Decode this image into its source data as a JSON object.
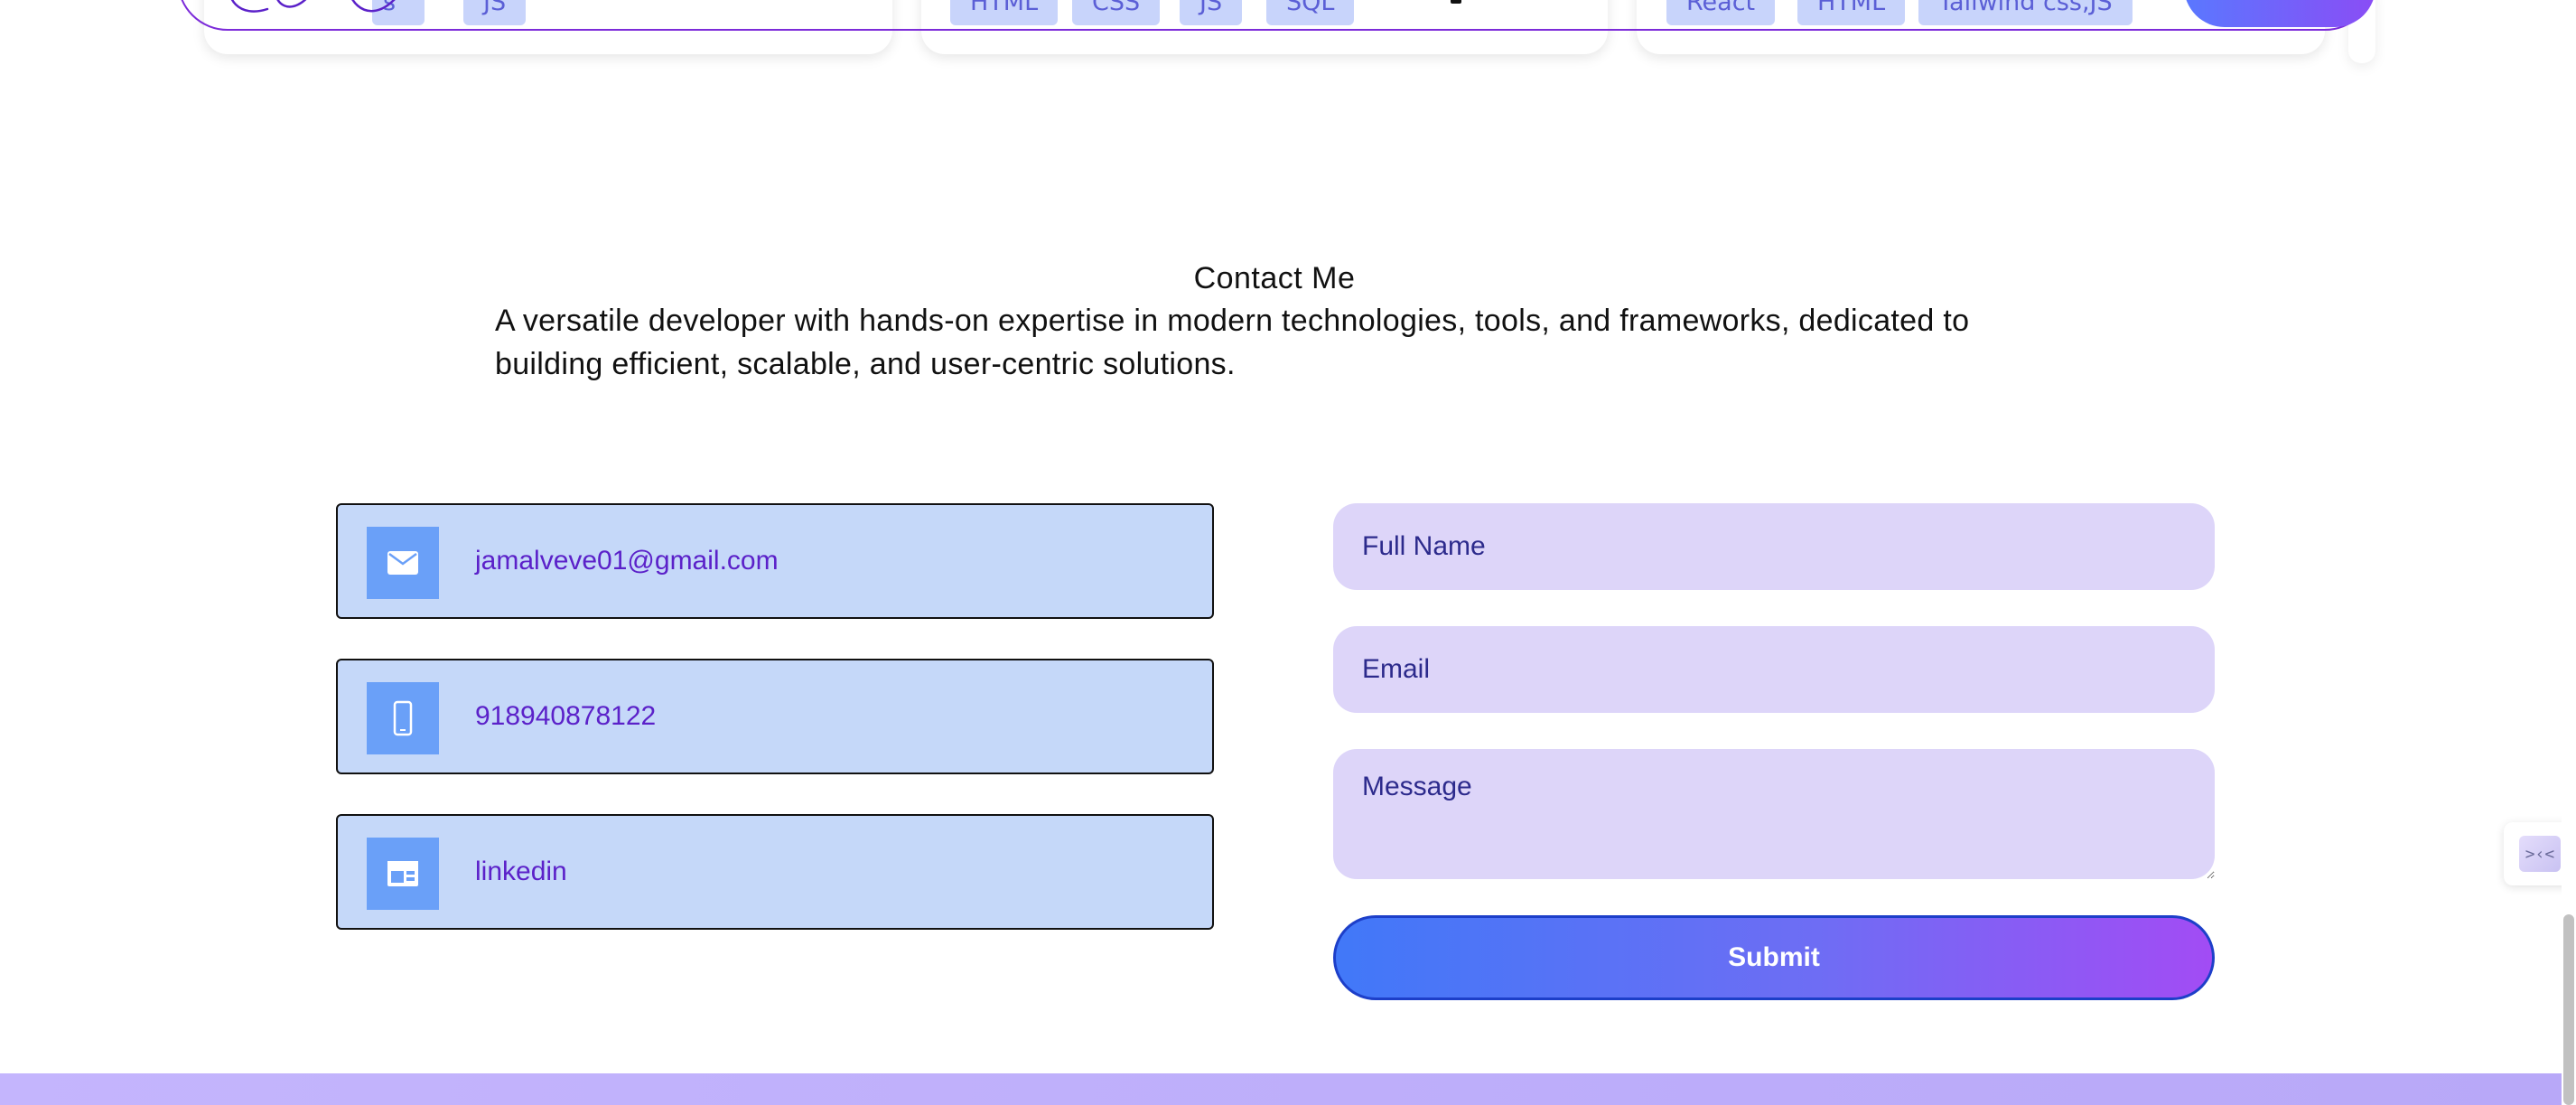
{
  "projects": {
    "cards": [
      {
        "tags": [
          "s",
          "JS"
        ]
      },
      {
        "tags": [
          "HTML",
          "CSS",
          "JS",
          "SQL"
        ]
      },
      {
        "tags": [
          "React",
          "HTML",
          "Tailwind css,JS"
        ]
      }
    ]
  },
  "navbar": {
    "logo_icon": "signature-logo",
    "cta_icon": "cta-button"
  },
  "contact": {
    "title": "Contact Me",
    "description": "A versatile developer with hands-on expertise in modern technologies, tools, and frameworks, dedicated to building efficient, scalable, and user-centric solutions.",
    "info": [
      {
        "icon": "mail-icon",
        "text": "jamalveve01@gmail.com"
      },
      {
        "icon": "phone-icon",
        "text": "918940878122"
      },
      {
        "icon": "linkedin-icon",
        "text": "linkedin"
      }
    ],
    "form": {
      "name_placeholder": "Full Name",
      "email_placeholder": "Email",
      "message_placeholder": "Message",
      "submit_label": "Submit"
    }
  },
  "side_widget": {
    "icon": "collapse-icon",
    "glyph": ">‹<"
  },
  "colors": {
    "accent_purple": "#7c2bd9",
    "info_box_bg": "#c5d8f9",
    "info_icon_bg": "#6aa0f8",
    "info_text": "#5b21c9",
    "field_bg": "#ddd5f9",
    "field_text": "#2c2a8c",
    "submit_gradient_start": "#4178f8",
    "submit_gradient_end": "#a24cf4",
    "footer_band": "#c4b5fd"
  }
}
